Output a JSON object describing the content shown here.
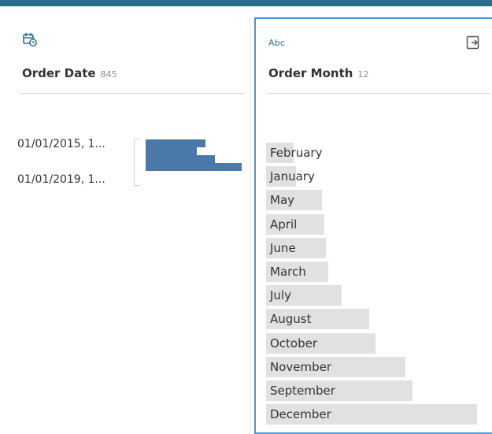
{
  "colors": {
    "accent": "#2c6e8f",
    "selected_border": "#4d97d1",
    "histogram_bar": "#4a78a8",
    "value_bar": "#e1e1e1"
  },
  "fields": [
    {
      "icon": "calendar-clock-icon",
      "name": "Order Date",
      "count": "845",
      "ranges": [
        {
          "label": "01/01/2015, 1..."
        },
        {
          "label": "01/01/2019, 1..."
        }
      ],
      "histogram_relative_counts": [
        0.62,
        0.53,
        0.72,
        1.0
      ]
    },
    {
      "type_label": "Abc",
      "name": "Order Month",
      "count": "12",
      "action_icon": "export-icon",
      "values": [
        {
          "label": "February",
          "relative_count": 0.13
        },
        {
          "label": "January",
          "relative_count": 0.14
        },
        {
          "label": "May",
          "relative_count": 0.26
        },
        {
          "label": "April",
          "relative_count": 0.27
        },
        {
          "label": "June",
          "relative_count": 0.28
        },
        {
          "label": "March",
          "relative_count": 0.29
        },
        {
          "label": "July",
          "relative_count": 0.35
        },
        {
          "label": "August",
          "relative_count": 0.48
        },
        {
          "label": "October",
          "relative_count": 0.51
        },
        {
          "label": "November",
          "relative_count": 0.65
        },
        {
          "label": "September",
          "relative_count": 0.68
        },
        {
          "label": "December",
          "relative_count": 0.98
        }
      ]
    }
  ]
}
